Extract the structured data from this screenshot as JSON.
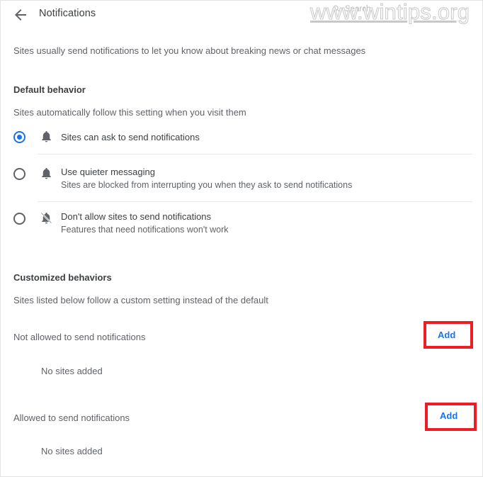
{
  "header": {
    "back_icon": "back-arrow-icon",
    "title": "Notifications",
    "search": {
      "icon": "search-icon",
      "placeholder": "Search",
      "value": ""
    },
    "watermark": "www.wintips.org"
  },
  "intro": "Sites usually send notifications to let you know about breaking news or chat messages",
  "default_behavior": {
    "title": "Default behavior",
    "subtitle": "Sites automatically follow this setting when you visit them",
    "options": [
      {
        "icon": "bell-icon",
        "label": "Sites can ask to send notifications",
        "description": "",
        "selected": true
      },
      {
        "icon": "bell-icon",
        "label": "Use quieter messaging",
        "description": "Sites are blocked from interrupting you when they ask to send notifications",
        "selected": false
      },
      {
        "icon": "bell-off-icon",
        "label": "Don't allow sites to send notifications",
        "description": "Features that need notifications won't work",
        "selected": false
      }
    ]
  },
  "customized_behaviors": {
    "title": "Customized behaviors",
    "subtitle": "Sites listed below follow a custom setting instead of the default",
    "groups": [
      {
        "label": "Not allowed to send notifications",
        "add_label": "Add",
        "empty_text": "No sites added",
        "sites": []
      },
      {
        "label": "Allowed to send notifications",
        "add_label": "Add",
        "empty_text": "No sites added",
        "sites": []
      }
    ]
  },
  "colors": {
    "accent": "#1a73e8",
    "annotation": "#ee1d23",
    "primary_text": "#3c4043",
    "secondary_text": "#5f6368",
    "divider": "#e8eaed"
  }
}
